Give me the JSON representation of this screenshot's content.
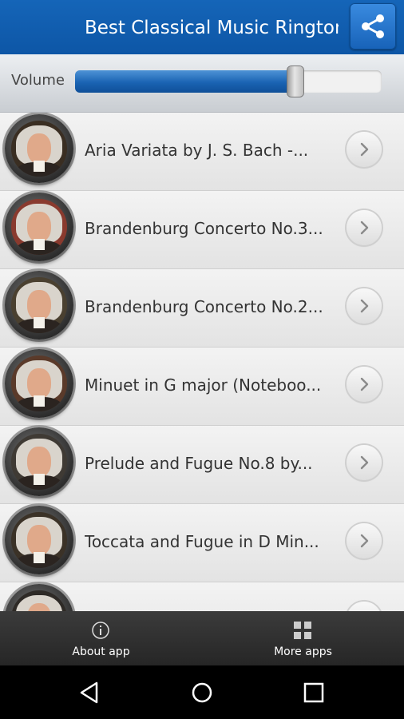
{
  "header": {
    "title": "Best Classical Music Ringtones",
    "share_icon": "share-icon"
  },
  "volume": {
    "label": "Volume",
    "level": 0.72
  },
  "ringtones": [
    {
      "title": "Aria Variata by J. S. Bach -...",
      "tint": "#3a2e22"
    },
    {
      "title": "Brandenburg Concerto No.3...",
      "tint": "#8a3a2e"
    },
    {
      "title": "Brandenburg Concerto No.2...",
      "tint": "#4a4030"
    },
    {
      "title": "Minuet in G major (Noteboo...",
      "tint": "#5a3a2a"
    },
    {
      "title": "Prelude and Fugue No.8 by...",
      "tint": "#3f3a34"
    },
    {
      "title": "Toccata and Fugue in D Min...",
      "tint": "#3b3227"
    },
    {
      "title": "",
      "tint": "#2e2a26"
    }
  ],
  "bottom_nav": {
    "about": {
      "label": "About app",
      "icon": "info-icon"
    },
    "more": {
      "label": "More apps",
      "icon": "grid-icon"
    }
  },
  "system_nav": {
    "back": "back-icon",
    "home": "home-icon",
    "recents": "recents-icon"
  }
}
